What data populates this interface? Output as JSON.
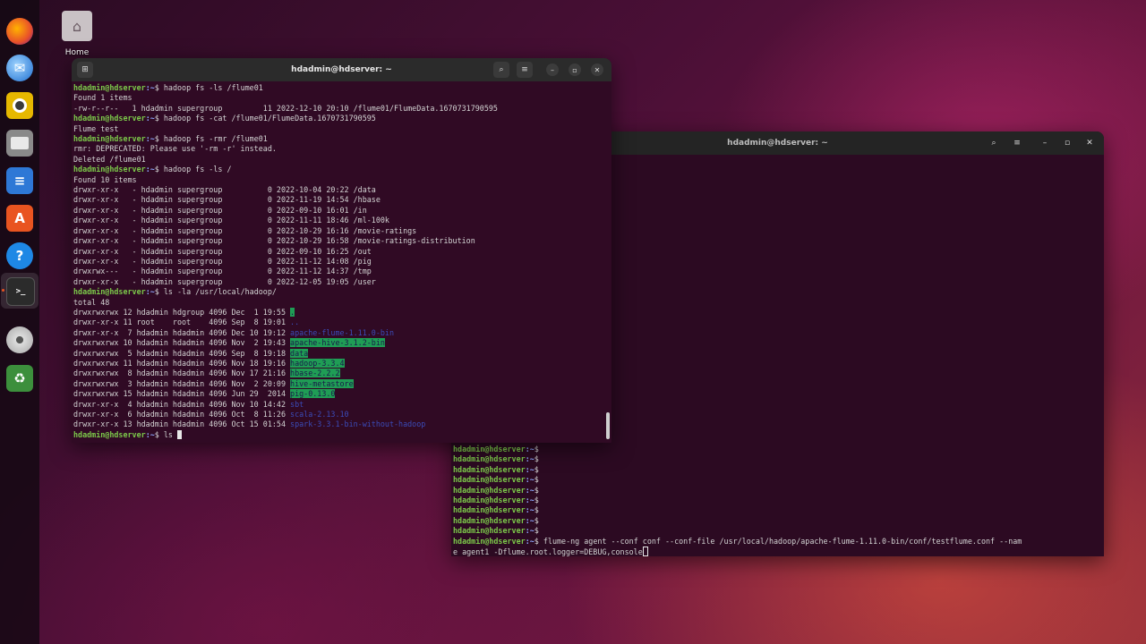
{
  "desktop": {
    "home_label": "Home"
  },
  "dock": {
    "items": [
      "firefox-icon",
      "thunderbird-icon",
      "rhythmbox-icon",
      "files-icon",
      "writer-icon",
      "app-center-icon",
      "help-icon",
      "terminal-icon",
      "disc-icon",
      "trash-icon"
    ]
  },
  "term1": {
    "title": "hdadmin@hdserver: ~",
    "prompt_user": "hdadmin@hdserver",
    "prompt_path": ":~",
    "lines": [
      {
        "type": "prompt",
        "cmd": "$ hadoop fs -ls /flume01"
      },
      {
        "type": "out",
        "text": "Found 1 items"
      },
      {
        "type": "out",
        "text": "-rw-r--r--   1 hdadmin supergroup         11 2022-12-10 20:10 /flume01/FlumeData.1670731790595"
      },
      {
        "type": "prompt",
        "cmd": "$ hadoop fs -cat /flume01/FlumeData.1670731790595"
      },
      {
        "type": "out",
        "text": "Flume test"
      },
      {
        "type": "prompt",
        "cmd": "$ hadoop fs -rmr /flume01"
      },
      {
        "type": "out",
        "text": "rmr: DEPRECATED: Please use '-rm -r' instead."
      },
      {
        "type": "out",
        "text": "Deleted /flume01"
      },
      {
        "type": "prompt",
        "cmd": "$ hadoop fs -ls /"
      },
      {
        "type": "out",
        "text": "Found 10 items"
      },
      {
        "type": "out",
        "text": "drwxr-xr-x   - hdadmin supergroup          0 2022-10-04 20:22 /data"
      },
      {
        "type": "out",
        "text": "drwxr-xr-x   - hdadmin supergroup          0 2022-11-19 14:54 /hbase"
      },
      {
        "type": "out",
        "text": "drwxr-xr-x   - hdadmin supergroup          0 2022-09-10 16:01 /in"
      },
      {
        "type": "out",
        "text": "drwxr-xr-x   - hdadmin supergroup          0 2022-11-11 18:46 /ml-100k"
      },
      {
        "type": "out",
        "text": "drwxr-xr-x   - hdadmin supergroup          0 2022-10-29 16:16 /movie-ratings"
      },
      {
        "type": "out",
        "text": "drwxr-xr-x   - hdadmin supergroup          0 2022-10-29 16:58 /movie-ratings-distribution"
      },
      {
        "type": "out",
        "text": "drwxr-xr-x   - hdadmin supergroup          0 2022-09-10 16:25 /out"
      },
      {
        "type": "out",
        "text": "drwxr-xr-x   - hdadmin supergroup          0 2022-11-12 14:08 /pig"
      },
      {
        "type": "out",
        "text": "drwxrwx---   - hdadmin supergroup          0 2022-11-12 14:37 /tmp"
      },
      {
        "type": "out",
        "text": "drwxr-xr-x   - hdadmin supergroup          0 2022-12-05 19:05 /user"
      },
      {
        "type": "prompt",
        "cmd": "$ ls -la /usr/local/hadoop/"
      },
      {
        "type": "out",
        "text": "total 48"
      },
      {
        "type": "ls",
        "text": "drwxrwxrwx 12 hdadmin hdgroup 4096 Dec  1 19:55 ",
        "name": ".",
        "style": "sel"
      },
      {
        "type": "ls",
        "text": "drwxr-xr-x 11 root    root    4096 Sep  8 19:01 ",
        "name": "..",
        "style": "dim"
      },
      {
        "type": "ls",
        "text": "drwxr-xr-x  7 hdadmin hdadmin 4096 Dec 10 19:12 ",
        "name": "apache-flume-1.11.0-bin",
        "style": "dim"
      },
      {
        "type": "ls",
        "text": "drwxrwxrwx 10 hdadmin hdadmin 4096 Nov  2 19:43 ",
        "name": "apache-hive-3.1.2-bin",
        "style": "sel"
      },
      {
        "type": "ls",
        "text": "drwxrwxrwx  5 hdadmin hdadmin 4096 Sep  8 19:18 ",
        "name": "data",
        "style": "sel"
      },
      {
        "type": "ls",
        "text": "drwxrwxrwx 11 hdadmin hdadmin 4096 Nov 18 19:16 ",
        "name": "hadoop-3.3.4",
        "style": "sel"
      },
      {
        "type": "ls",
        "text": "drwxrwxrwx  8 hdadmin hdadmin 4096 Nov 17 21:16 ",
        "name": "hbase-2.2.2",
        "style": "sel"
      },
      {
        "type": "ls",
        "text": "drwxrwxrwx  3 hdadmin hdadmin 4096 Nov  2 20:09 ",
        "name": "hive-metastore",
        "style": "sel"
      },
      {
        "type": "ls",
        "text": "drwxrwxrwx 15 hdadmin hdadmin 4096 Jun 29  2014 ",
        "name": "pig-0.13.0",
        "style": "sel"
      },
      {
        "type": "ls",
        "text": "drwxr-xr-x  4 hdadmin hdadmin 4096 Nov 10 14:42 ",
        "name": "sbt",
        "style": "dim"
      },
      {
        "type": "ls",
        "text": "drwxr-xr-x  6 hdadmin hdadmin 4096 Oct  8 11:26 ",
        "name": "scala-2.13.10",
        "style": "dim"
      },
      {
        "type": "ls",
        "text": "drwxr-xr-x 13 hdadmin hdadmin 4096 Oct 15 01:54 ",
        "name": "spark-3.3.1-bin-without-hadoop",
        "style": "dim"
      },
      {
        "type": "prompt",
        "cmd": "$ ls ",
        "cursor": true
      }
    ]
  },
  "term2": {
    "title": "hdadmin@hdserver: ~",
    "prompt_user": "hdadmin@hdserver",
    "prompt_path": ":~",
    "empty_prompts": 9,
    "last_cmd_line1": "$ flume-ng agent --conf conf --conf-file /usr/local/hadoop/apache-flume-1.11.0-bin/conf/testflume.conf --nam",
    "last_cmd_line2": "e agent1 -Dflume.root.logger=DEBUG,console"
  }
}
